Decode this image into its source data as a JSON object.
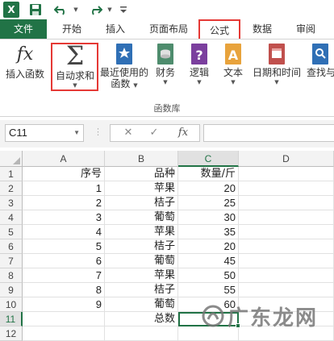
{
  "app": {
    "logo_text": "X"
  },
  "tabs": [
    {
      "id": "file",
      "label": "文件"
    },
    {
      "id": "home",
      "label": "开始"
    },
    {
      "id": "insert",
      "label": "插入"
    },
    {
      "id": "layout",
      "label": "页面布局"
    },
    {
      "id": "formulas",
      "label": "公式"
    },
    {
      "id": "data",
      "label": "数据"
    },
    {
      "id": "review",
      "label": "审阅"
    }
  ],
  "ribbon": {
    "insert_function": "插入函数",
    "autosum": "自动求和",
    "recent_line1": "最近使用的",
    "recent_line2": "函数",
    "financial": "财务",
    "logical": "逻辑",
    "text": "文本",
    "datetime": "日期和时间",
    "lookup": "查找与",
    "group_label": "函数库",
    "dropdown_arrow": "▼"
  },
  "formula_bar": {
    "name_box": "C11",
    "cancel": "✕",
    "enter": "✓",
    "fx": "fx",
    "content": ""
  },
  "columns": [
    "A",
    "B",
    "C",
    "D"
  ],
  "rows": [
    "1",
    "2",
    "3",
    "4",
    "5",
    "6",
    "7",
    "8",
    "9",
    "10",
    "11",
    "12"
  ],
  "cells": {
    "A": [
      "序号",
      "1",
      "2",
      "3",
      "4",
      "5",
      "6",
      "7",
      "8",
      "9",
      "",
      ""
    ],
    "B": [
      "品种",
      "苹果",
      "桔子",
      "葡萄",
      "苹果",
      "桔子",
      "葡萄",
      "苹果",
      "桔子",
      "葡萄",
      "总数",
      ""
    ],
    "C": [
      "数量/斤",
      "20",
      "25",
      "30",
      "35",
      "20",
      "45",
      "50",
      "55",
      "60",
      "",
      ""
    ],
    "D": [
      "",
      "",
      "",
      "",
      "",
      "",
      "",
      "",
      "",
      "",
      "",
      ""
    ]
  },
  "watermark": {
    "text": "广东龙网"
  },
  "colors": {
    "excel_green": "#217346",
    "highlight_red": "#e53935"
  }
}
